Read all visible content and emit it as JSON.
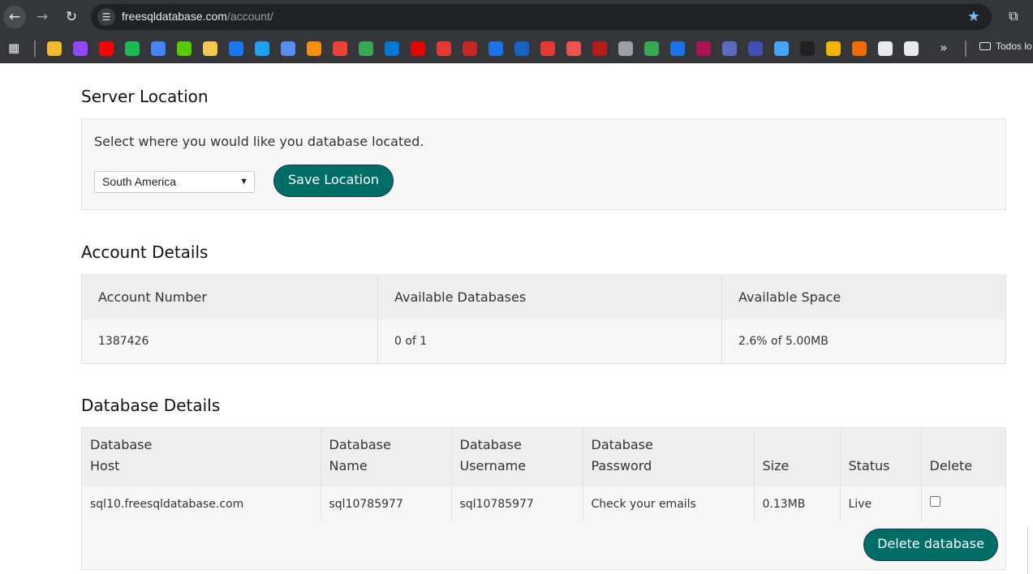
{
  "browser": {
    "url_host": "freesqldatabase.com",
    "url_path": "/account/",
    "bookmark_folder": "Todos lo",
    "bookmark_colors": [
      "#f3ba2f",
      "#9146ff",
      "#ff0000",
      "#1db954",
      "#4285f4",
      "#58cc02",
      "#f2c94c",
      "#1877f2",
      "#1da1f2",
      "#5a8dee",
      "#f29111",
      "#ea4335",
      "#34a853",
      "#0078d4",
      "#e10600",
      "#e53935",
      "#c62828",
      "#1a73e8",
      "#1565c0",
      "#e53935",
      "#ef5350",
      "#b71c1c",
      "#9aa0a6",
      "#34a853",
      "#1a73e8",
      "#ad1457",
      "#5c6bc0",
      "#3f51b5",
      "#42a5f5",
      "#212121",
      "#f4b400",
      "#ef6c00",
      "#e8eaed",
      "#e8eaed"
    ]
  },
  "server_location": {
    "title": "Server Location",
    "prompt": "Select where you would like you database located.",
    "selected_region": "South America",
    "save_label": "Save Location"
  },
  "account": {
    "title": "Account Details",
    "headers": [
      "Account Number",
      "Available Databases",
      "Available Space"
    ],
    "values": [
      "1387426",
      "0 of 1",
      "2.6% of 5.00MB"
    ]
  },
  "database": {
    "title": "Database Details",
    "headers": [
      [
        "Database",
        "Host"
      ],
      [
        "Database",
        "Name"
      ],
      [
        "Database",
        "Username"
      ],
      [
        "Database",
        "Password"
      ],
      [
        "",
        "Size"
      ],
      [
        "",
        "Status"
      ],
      [
        "",
        "Delete"
      ]
    ],
    "row": {
      "host": "sql10.freesqldatabase.com",
      "name": "sql10785977",
      "username": "sql10785977",
      "password": "Check your emails",
      "size": "0.13MB",
      "status": "Live",
      "delete_checked": false
    },
    "delete_label": "Delete database"
  },
  "colors": {
    "accent": "#006d66",
    "panel": "#f7f7f7",
    "header": "#eeeeee"
  }
}
